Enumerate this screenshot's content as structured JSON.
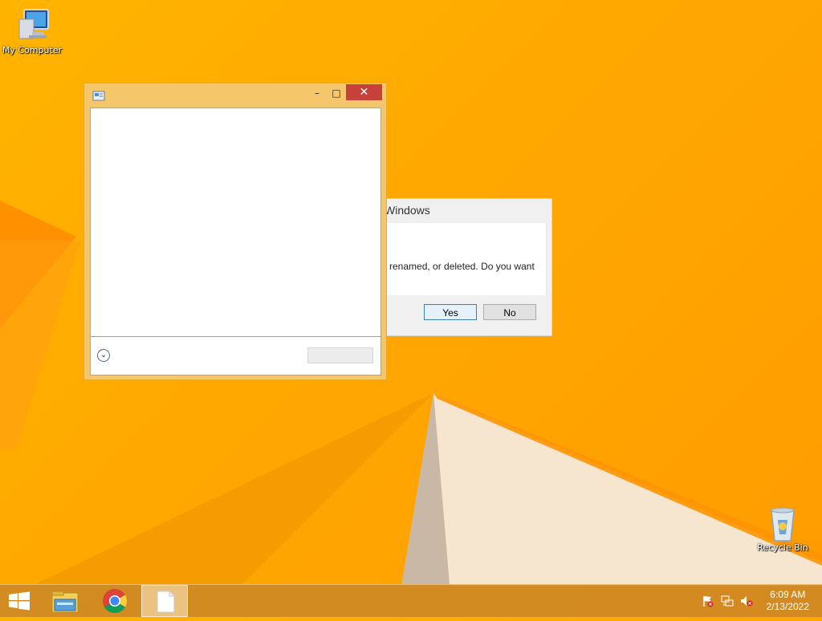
{
  "desktop": {
    "icons": [
      {
        "label": "My Computer",
        "icon": "computer-icon"
      },
      {
        "label": "Recycle Bin",
        "icon": "recycle-bin-icon"
      }
    ]
  },
  "back_dialog": {
    "title": "Windows",
    "message": "renamed, or deleted. Do you want",
    "yes_label": "Yes",
    "no_label": "No"
  },
  "front_window": {
    "title": "",
    "minimize_label": "–",
    "maximize_label": "□",
    "close_label": "✕",
    "expand_label": "⌄"
  },
  "taskbar": {
    "items": [
      {
        "icon": "windows-start-icon"
      },
      {
        "icon": "file-explorer-icon"
      },
      {
        "icon": "chrome-icon"
      },
      {
        "icon": "blank-document-icon",
        "active": true
      }
    ],
    "tray": [
      "action-center-flag-icon",
      "network-icon",
      "volume-muted-icon"
    ],
    "time": "6:09 AM",
    "date": "2/13/2022"
  },
  "colors": {
    "desktop": "#ffa800",
    "window_frame": "#f6c66a",
    "close_button": "#c7403a",
    "taskbar": "#cc8826"
  }
}
